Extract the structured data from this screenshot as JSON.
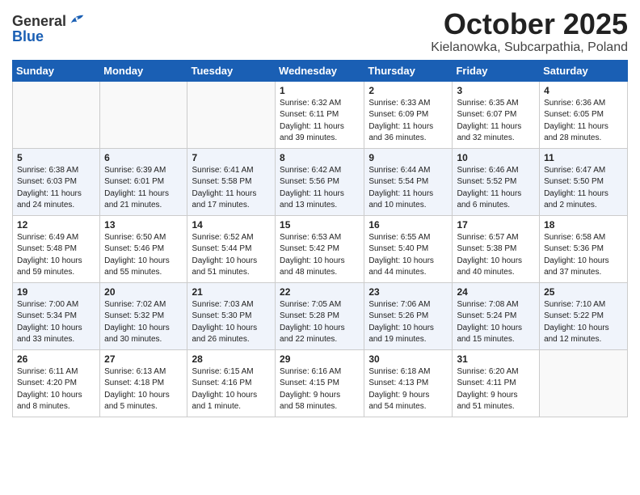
{
  "header": {
    "logo_general": "General",
    "logo_blue": "Blue",
    "month": "October 2025",
    "location": "Kielanowka, Subcarpathia, Poland"
  },
  "weekdays": [
    "Sunday",
    "Monday",
    "Tuesday",
    "Wednesday",
    "Thursday",
    "Friday",
    "Saturday"
  ],
  "weeks": [
    [
      {
        "day": "",
        "info": ""
      },
      {
        "day": "",
        "info": ""
      },
      {
        "day": "",
        "info": ""
      },
      {
        "day": "1",
        "info": "Sunrise: 6:32 AM\nSunset: 6:11 PM\nDaylight: 11 hours\nand 39 minutes."
      },
      {
        "day": "2",
        "info": "Sunrise: 6:33 AM\nSunset: 6:09 PM\nDaylight: 11 hours\nand 36 minutes."
      },
      {
        "day": "3",
        "info": "Sunrise: 6:35 AM\nSunset: 6:07 PM\nDaylight: 11 hours\nand 32 minutes."
      },
      {
        "day": "4",
        "info": "Sunrise: 6:36 AM\nSunset: 6:05 PM\nDaylight: 11 hours\nand 28 minutes."
      }
    ],
    [
      {
        "day": "5",
        "info": "Sunrise: 6:38 AM\nSunset: 6:03 PM\nDaylight: 11 hours\nand 24 minutes."
      },
      {
        "day": "6",
        "info": "Sunrise: 6:39 AM\nSunset: 6:01 PM\nDaylight: 11 hours\nand 21 minutes."
      },
      {
        "day": "7",
        "info": "Sunrise: 6:41 AM\nSunset: 5:58 PM\nDaylight: 11 hours\nand 17 minutes."
      },
      {
        "day": "8",
        "info": "Sunrise: 6:42 AM\nSunset: 5:56 PM\nDaylight: 11 hours\nand 13 minutes."
      },
      {
        "day": "9",
        "info": "Sunrise: 6:44 AM\nSunset: 5:54 PM\nDaylight: 11 hours\nand 10 minutes."
      },
      {
        "day": "10",
        "info": "Sunrise: 6:46 AM\nSunset: 5:52 PM\nDaylight: 11 hours\nand 6 minutes."
      },
      {
        "day": "11",
        "info": "Sunrise: 6:47 AM\nSunset: 5:50 PM\nDaylight: 11 hours\nand 2 minutes."
      }
    ],
    [
      {
        "day": "12",
        "info": "Sunrise: 6:49 AM\nSunset: 5:48 PM\nDaylight: 10 hours\nand 59 minutes."
      },
      {
        "day": "13",
        "info": "Sunrise: 6:50 AM\nSunset: 5:46 PM\nDaylight: 10 hours\nand 55 minutes."
      },
      {
        "day": "14",
        "info": "Sunrise: 6:52 AM\nSunset: 5:44 PM\nDaylight: 10 hours\nand 51 minutes."
      },
      {
        "day": "15",
        "info": "Sunrise: 6:53 AM\nSunset: 5:42 PM\nDaylight: 10 hours\nand 48 minutes."
      },
      {
        "day": "16",
        "info": "Sunrise: 6:55 AM\nSunset: 5:40 PM\nDaylight: 10 hours\nand 44 minutes."
      },
      {
        "day": "17",
        "info": "Sunrise: 6:57 AM\nSunset: 5:38 PM\nDaylight: 10 hours\nand 40 minutes."
      },
      {
        "day": "18",
        "info": "Sunrise: 6:58 AM\nSunset: 5:36 PM\nDaylight: 10 hours\nand 37 minutes."
      }
    ],
    [
      {
        "day": "19",
        "info": "Sunrise: 7:00 AM\nSunset: 5:34 PM\nDaylight: 10 hours\nand 33 minutes."
      },
      {
        "day": "20",
        "info": "Sunrise: 7:02 AM\nSunset: 5:32 PM\nDaylight: 10 hours\nand 30 minutes."
      },
      {
        "day": "21",
        "info": "Sunrise: 7:03 AM\nSunset: 5:30 PM\nDaylight: 10 hours\nand 26 minutes."
      },
      {
        "day": "22",
        "info": "Sunrise: 7:05 AM\nSunset: 5:28 PM\nDaylight: 10 hours\nand 22 minutes."
      },
      {
        "day": "23",
        "info": "Sunrise: 7:06 AM\nSunset: 5:26 PM\nDaylight: 10 hours\nand 19 minutes."
      },
      {
        "day": "24",
        "info": "Sunrise: 7:08 AM\nSunset: 5:24 PM\nDaylight: 10 hours\nand 15 minutes."
      },
      {
        "day": "25",
        "info": "Sunrise: 7:10 AM\nSunset: 5:22 PM\nDaylight: 10 hours\nand 12 minutes."
      }
    ],
    [
      {
        "day": "26",
        "info": "Sunrise: 6:11 AM\nSunset: 4:20 PM\nDaylight: 10 hours\nand 8 minutes."
      },
      {
        "day": "27",
        "info": "Sunrise: 6:13 AM\nSunset: 4:18 PM\nDaylight: 10 hours\nand 5 minutes."
      },
      {
        "day": "28",
        "info": "Sunrise: 6:15 AM\nSunset: 4:16 PM\nDaylight: 10 hours\nand 1 minute."
      },
      {
        "day": "29",
        "info": "Sunrise: 6:16 AM\nSunset: 4:15 PM\nDaylight: 9 hours\nand 58 minutes."
      },
      {
        "day": "30",
        "info": "Sunrise: 6:18 AM\nSunset: 4:13 PM\nDaylight: 9 hours\nand 54 minutes."
      },
      {
        "day": "31",
        "info": "Sunrise: 6:20 AM\nSunset: 4:11 PM\nDaylight: 9 hours\nand 51 minutes."
      },
      {
        "day": "",
        "info": ""
      }
    ]
  ]
}
